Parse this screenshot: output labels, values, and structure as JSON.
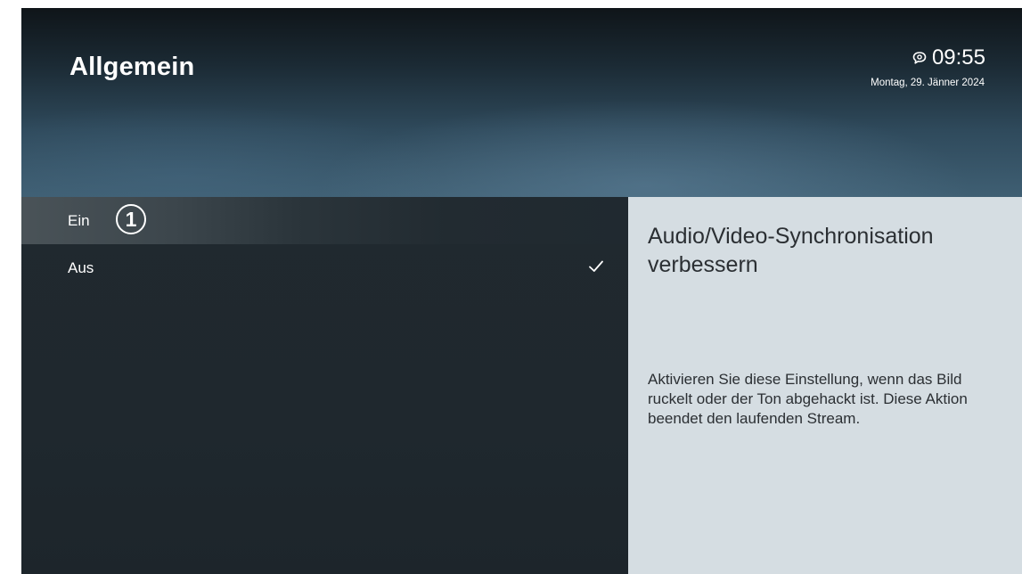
{
  "header": {
    "title": "Allgemein",
    "time": "09:55",
    "date": "Montag, 29. Jänner 2024",
    "status_icon": "speech-bubble-icon"
  },
  "options": [
    {
      "label": "Ein",
      "focused": true,
      "marker": "1"
    },
    {
      "label": "Aus",
      "selected": true,
      "check_icon": "checkmark-icon"
    }
  ],
  "info": {
    "title": "Audio/Video-Synchronisation verbessern",
    "description": "Aktivieren Sie diese Einstellung, wenn das Bild ruckelt oder der Ton abgehackt ist. Diese Aktion beendet den laufenden Stream."
  },
  "colors": {
    "panel_dark": "#1f282e",
    "panel_light": "#d5dde2",
    "text_light": "#ffffff",
    "text_dark": "#2b2f33"
  }
}
